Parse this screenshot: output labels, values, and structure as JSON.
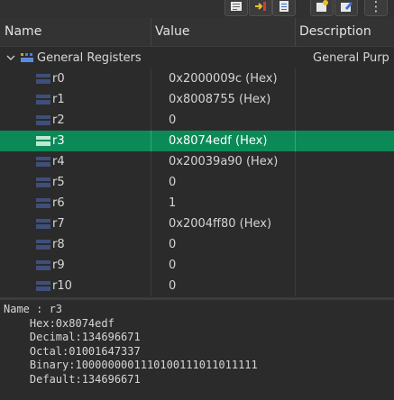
{
  "toolbar": {
    "buttons": [
      {
        "icon": "memory-view-icon"
      },
      {
        "icon": "move-register-icon"
      },
      {
        "icon": "register-list-icon"
      },
      {
        "icon": "new-tab-icon"
      },
      {
        "icon": "edit-icon"
      },
      {
        "icon": "more-vertical-icon",
        "glyph": "⋮"
      }
    ]
  },
  "columns": {
    "name": "Name",
    "value": "Value",
    "description": "Description"
  },
  "group": {
    "label": "General Registers",
    "description": "General Purp",
    "expanded": true
  },
  "registers": [
    {
      "name": "r0",
      "value": "0x2000009c (Hex)",
      "selected": false
    },
    {
      "name": "r1",
      "value": "0x8008755 (Hex)",
      "selected": false
    },
    {
      "name": "r2",
      "value": "0",
      "selected": false
    },
    {
      "name": "r3",
      "value": "0x8074edf (Hex)",
      "selected": true
    },
    {
      "name": "r4",
      "value": "0x20039a90 (Hex)",
      "selected": false
    },
    {
      "name": "r5",
      "value": "0",
      "selected": false
    },
    {
      "name": "r6",
      "value": "1",
      "selected": false
    },
    {
      "name": "r7",
      "value": "0x2004ff80 (Hex)",
      "selected": false
    },
    {
      "name": "r8",
      "value": "0",
      "selected": false
    },
    {
      "name": "r9",
      "value": "0",
      "selected": false
    },
    {
      "name": "r10",
      "value": "0",
      "selected": false
    }
  ],
  "details": {
    "lines": [
      "Name : r3",
      "    Hex:0x8074edf",
      "    Decimal:134696671",
      "    Octal:01001647337",
      "    Binary:1000000001110100111011011111",
      "    Default:134696671"
    ]
  },
  "colors": {
    "background": "#2b2b2b",
    "selection": "#0b8a58",
    "header": "#333333"
  }
}
